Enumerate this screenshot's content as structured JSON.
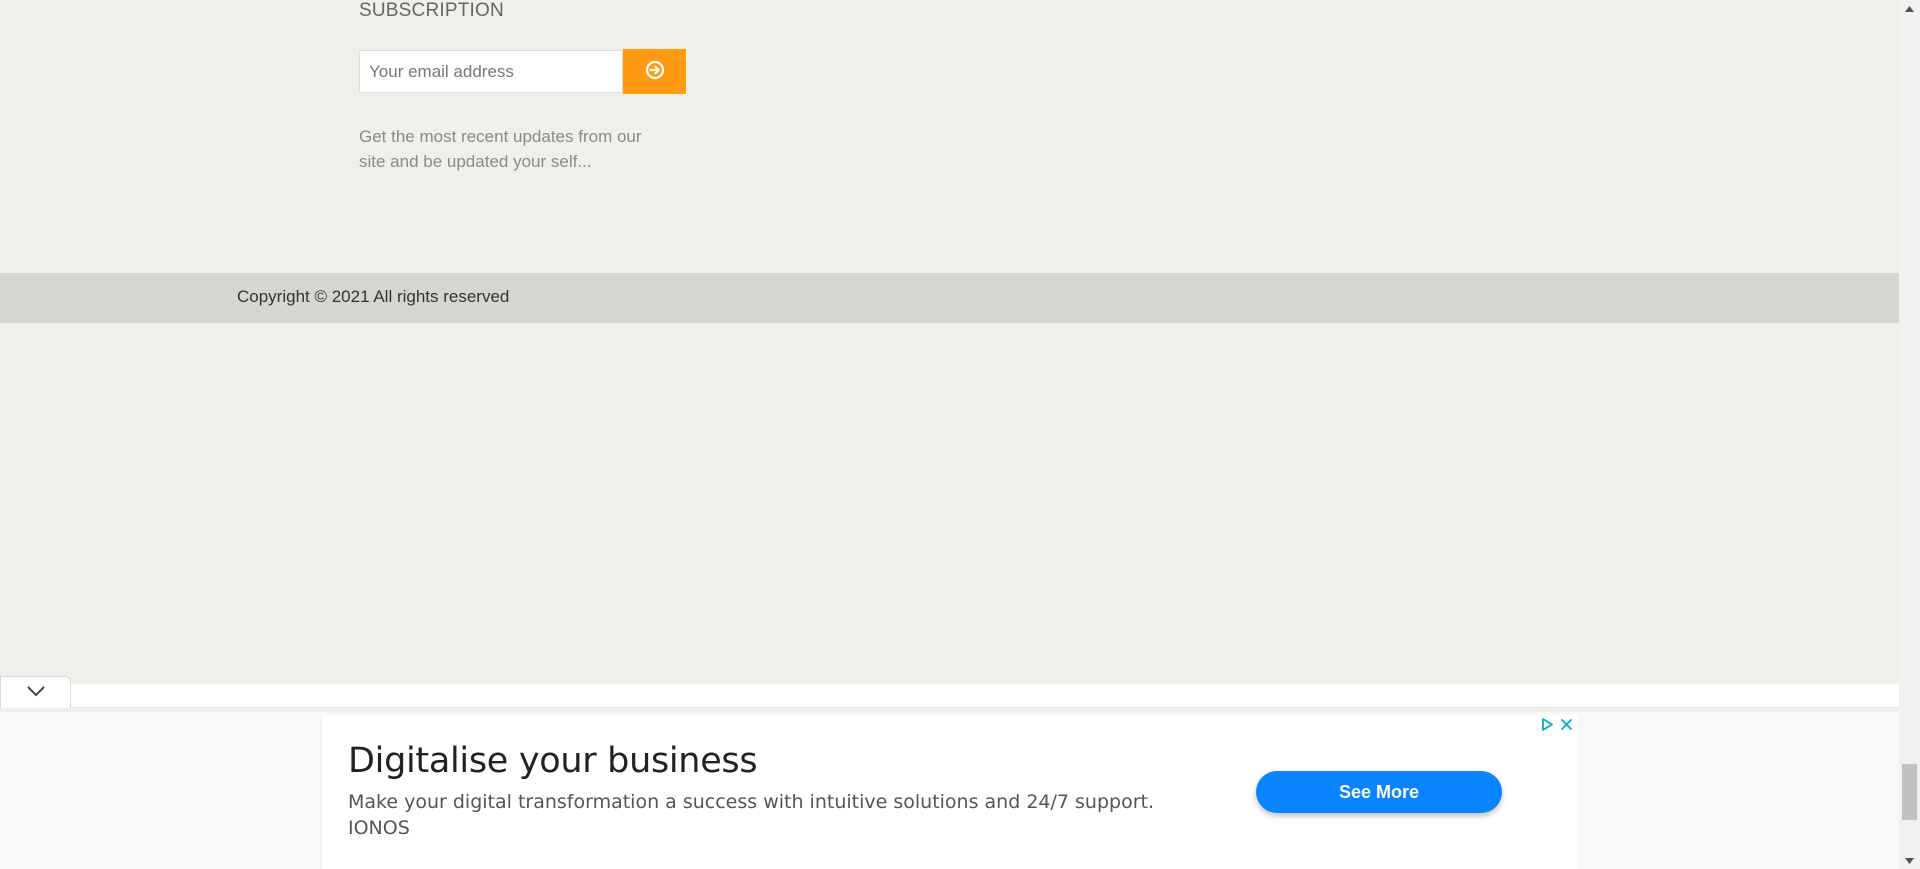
{
  "subscription": {
    "title": "SUBSCRIPTION",
    "email_placeholder": "Your email address",
    "description": "Get the most recent updates from our site and be updated your self..."
  },
  "footer": {
    "copyright": "Copyright © 2021 All rights reserved"
  },
  "ad": {
    "headline": "Digitalise your business",
    "body": "Make your digital transformation a success with intuitive solutions and 24/7 support.",
    "brand": "IONOS",
    "cta_label": "See More",
    "cta_color": "#0a84ff"
  },
  "colors": {
    "accent": "#ff9a12",
    "page_bg": "#f0efe9",
    "footer_bar": "#d6d6d0"
  },
  "icons": {
    "subscribe": "arrow-circle-right-icon",
    "ad_toggle": "chevron-down-icon",
    "ad_info": "ad-choices-icon",
    "ad_close": "close-icon"
  }
}
